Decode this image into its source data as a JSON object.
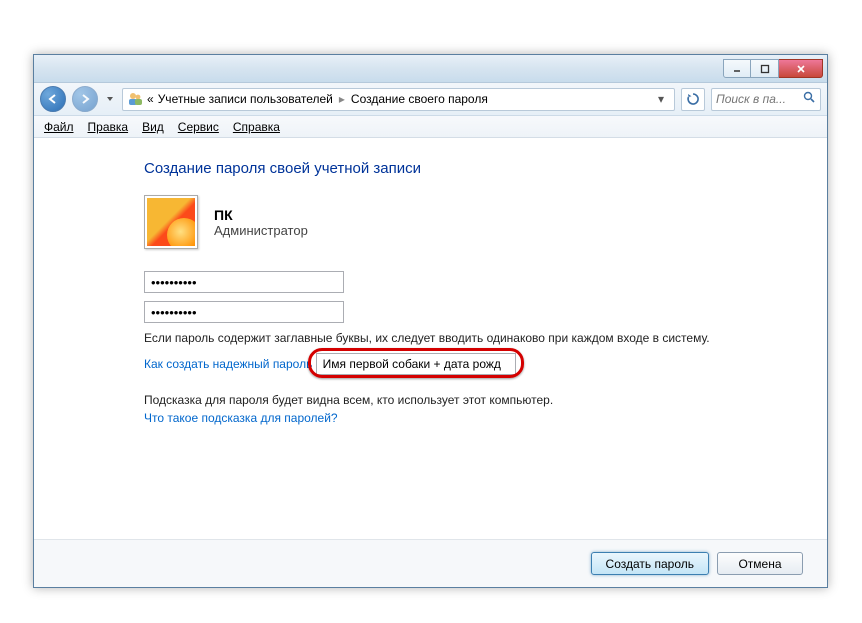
{
  "titlebar": {
    "minimize": "–",
    "maximize": "□",
    "close": "✕"
  },
  "breadcrumb": {
    "prefix": "«",
    "item1": "Учетные записи пользователей",
    "item2": "Создание своего пароля"
  },
  "search": {
    "placeholder": "Поиск в па..."
  },
  "menubar": {
    "file": "Файл",
    "edit": "Правка",
    "view": "Вид",
    "tools": "Сервис",
    "help": "Справка"
  },
  "page": {
    "title": "Создание пароля своей учетной записи",
    "account_name": "ПК",
    "account_role": "Администратор",
    "password_value": "••••••••••",
    "password_confirm_value": "••••••••••",
    "caps_note": "Если пароль содержит заглавные буквы, их следует вводить одинаково при каждом входе в систему.",
    "strong_link": "Как создать надежный пароль",
    "hint_value": "Имя первой собаки + дата рожд",
    "hint_note": "Подсказка для пароля будет видна всем, кто использует этот компьютер.",
    "hint_link": "Что такое подсказка для паролей?"
  },
  "buttons": {
    "create": "Создать пароль",
    "cancel": "Отмена"
  }
}
